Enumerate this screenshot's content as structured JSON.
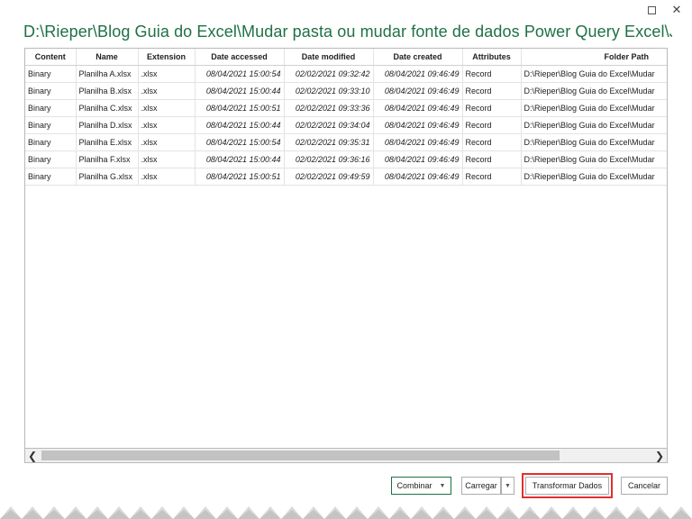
{
  "window": {
    "title": "D:\\Rieper\\Blog Guia do Excel\\Mudar pasta ou mudar fonte de dados Power Query Excel\\Juntar...",
    "maximize_glyph": "",
    "close_glyph": "✕"
  },
  "table": {
    "columns": [
      "Content",
      "Name",
      "Extension",
      "Date accessed",
      "Date modified",
      "Date created",
      "Attributes",
      "Folder Path"
    ],
    "rows": [
      [
        "Binary",
        "Planilha A.xlsx",
        ".xlsx",
        "08/04/2021 15:00:54",
        "02/02/2021 09:32:42",
        "08/04/2021 09:46:49",
        "Record",
        "D:\\Rieper\\Blog Guia do Excel\\Mudar"
      ],
      [
        "Binary",
        "Planilha B.xlsx",
        ".xlsx",
        "08/04/2021 15:00:44",
        "02/02/2021 09:33:10",
        "08/04/2021 09:46:49",
        "Record",
        "D:\\Rieper\\Blog Guia do Excel\\Mudar"
      ],
      [
        "Binary",
        "Planilha C.xlsx",
        ".xlsx",
        "08/04/2021 15:00:51",
        "02/02/2021 09:33:36",
        "08/04/2021 09:46:49",
        "Record",
        "D:\\Rieper\\Blog Guia do Excel\\Mudar"
      ],
      [
        "Binary",
        "Planilha D.xlsx",
        ".xlsx",
        "08/04/2021 15:00:44",
        "02/02/2021 09:34:04",
        "08/04/2021 09:46:49",
        "Record",
        "D:\\Rieper\\Blog Guia do Excel\\Mudar"
      ],
      [
        "Binary",
        "Planilha E.xlsx",
        ".xlsx",
        "08/04/2021 15:00:54",
        "02/02/2021 09:35:31",
        "08/04/2021 09:46:49",
        "Record",
        "D:\\Rieper\\Blog Guia do Excel\\Mudar"
      ],
      [
        "Binary",
        "Planilha F.xlsx",
        ".xlsx",
        "08/04/2021 15:00:44",
        "02/02/2021 09:36:16",
        "08/04/2021 09:46:49",
        "Record",
        "D:\\Rieper\\Blog Guia do Excel\\Mudar"
      ],
      [
        "Binary",
        "Planilha G.xlsx",
        ".xlsx",
        "08/04/2021 15:00:51",
        "02/02/2021 09:49:59",
        "08/04/2021 09:46:49",
        "Record",
        "D:\\Rieper\\Blog Guia do Excel\\Mudar"
      ]
    ]
  },
  "scrollbar": {
    "left_arrow": "❮",
    "right_arrow": "❯"
  },
  "footer": {
    "combinar_label": "Combinar",
    "carregar_label": "Carregar",
    "transformar_label": "Transformar Dados",
    "cancelar_label": "Cancelar",
    "dropdown_caret": "▼"
  },
  "colors": {
    "title": "#1e7145",
    "highlight": "#e0302f"
  }
}
